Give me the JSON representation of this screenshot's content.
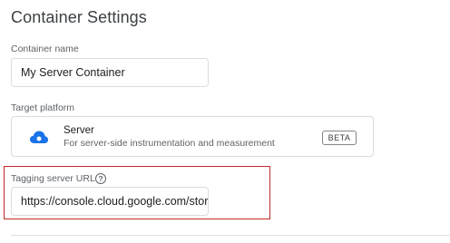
{
  "page": {
    "title": "Container Settings"
  },
  "container_name": {
    "label": "Container name",
    "value": "My Server Container"
  },
  "target_platform": {
    "label": "Target platform",
    "icon": "cloud-icon",
    "name": "Server",
    "description": "For server-side instrumentation and measurement",
    "badge": "BETA"
  },
  "tagging_server": {
    "label": "Tagging server URL",
    "help_icon": "help-icon",
    "help_glyph": "?",
    "value": "https://console.cloud.google.com/stora"
  },
  "colors": {
    "accent": "#1a73e8",
    "highlight": "#c62828",
    "text_secondary": "#5f6368"
  }
}
